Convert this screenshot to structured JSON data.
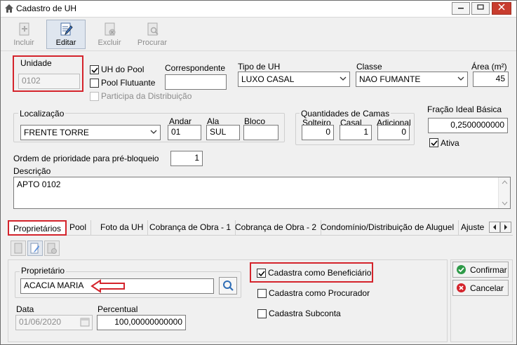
{
  "window": {
    "title": "Cadastro de UH"
  },
  "toolbar": {
    "incluir": "Incluir",
    "editar": "Editar",
    "excluir": "Excluir",
    "procurar": "Procurar"
  },
  "form": {
    "unidade_label": "Unidade",
    "unidade_value": "0102",
    "uh_do_pool_label": "UH do Pool",
    "uh_do_pool_checked": true,
    "pool_flutuante_label": "Pool Flutuante",
    "participa_label": "Participa da Distribuição",
    "correspondente_label": "Correspondente",
    "correspondente_value": "",
    "tipo_uh_label": "Tipo de UH",
    "tipo_uh_value": "LUXO CASAL",
    "classe_label": "Classe",
    "classe_value": "NAO FUMANTE",
    "area_label": "Área (m²)",
    "area_value": "45",
    "localizacao_label": "Localização",
    "localizacao_value": "FRENTE TORRE",
    "andar_label": "Andar",
    "andar_value": "01",
    "ala_label": "Ala",
    "ala_value": "SUL",
    "bloco_label": "Bloco",
    "bloco_value": "",
    "qtd_camas_label": "Quantidades de Camas",
    "solteiro_label": "Solteiro",
    "solteiro_value": "0",
    "casal_label": "Casal",
    "casal_value": "1",
    "adicional_label": "Adicional",
    "adicional_value": "0",
    "fracao_label": "Fração Ideal Básica",
    "fracao_value": "0,2500000000",
    "ativa_label": "Ativa",
    "ativa_checked": true,
    "ordem_label": "Ordem de prioridade para pré-bloqueio",
    "ordem_value": "1",
    "descricao_label": "Descrição",
    "descricao_value": "APTO 0102"
  },
  "tabs": [
    "Proprietários",
    "Pool",
    "Foto da UH",
    "Cobrança de Obra - 1",
    "Cobrança de Obra - 2",
    "Condomínio/Distribuição de Aluguel",
    "Ajuste"
  ],
  "proprietarios": {
    "proprietario_label": "Proprietário",
    "proprietario_value": "ACACIA MARIA",
    "data_label": "Data",
    "data_value": "01/06/2020",
    "percentual_label": "Percentual",
    "percentual_value": "100,00000000000",
    "beneficiario_label": "Cadastra como Beneficiário",
    "beneficiario_checked": true,
    "procurador_label": "Cadastra como Procurador",
    "subconta_label": "Cadastra Subconta",
    "confirmar_label": "Confirmar",
    "cancelar_label": "Cancelar"
  },
  "colors": {
    "highlight": "#d4232b",
    "confirm": "#2e9a48",
    "cancel": "#d4232b"
  }
}
